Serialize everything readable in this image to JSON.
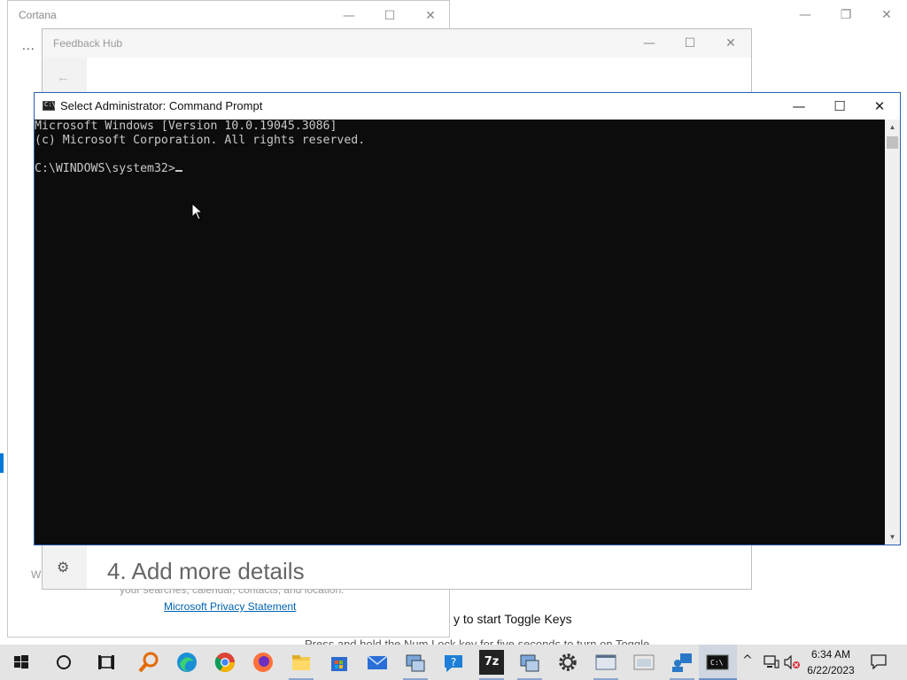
{
  "cortana": {
    "title": "Cortana",
    "dots": "...",
    "left_text": "Wi",
    "sub_text": "your searches, calendar, contacts, and location.",
    "privacy_link": "Microsoft Privacy Statement"
  },
  "background": {
    "toggle_keys_text": "y to start Toggle Keys",
    "numlock_text": "Press and hold the Num Lock key for five seconds to turn on Toggle"
  },
  "feedback_hub": {
    "title": "Feedback Hub",
    "back_glyph": "←",
    "settings_glyph": "⚙",
    "section_heading": "4. Add more details"
  },
  "cmd": {
    "title": "Select Administrator:  Command Prompt",
    "lines": [
      "Microsoft Windows [Version 10.0.19045.3086]",
      "(c) Microsoft Corporation. All rights reserved.",
      "",
      "C:\\WINDOWS\\system32>"
    ]
  },
  "window_controls": {
    "minimize": "—",
    "maximize": "☐",
    "close": "✕",
    "restore": "❐"
  },
  "taskbar": {
    "clock_time": "6:34 AM",
    "clock_date": "6/22/2023",
    "tray_chevron": "^",
    "apps": [
      {
        "name": "start-icon"
      },
      {
        "name": "cortana-search-icon"
      },
      {
        "name": "task-view-icon"
      },
      {
        "name": "search-magnifier-app-icon"
      },
      {
        "name": "edge-icon"
      },
      {
        "name": "chrome-icon"
      },
      {
        "name": "firefox-icon"
      },
      {
        "name": "file-explorer-icon"
      },
      {
        "name": "microsoft-store-icon"
      },
      {
        "name": "mail-icon"
      },
      {
        "name": "network-app-icon"
      },
      {
        "name": "help-icon"
      },
      {
        "name": "7zip-icon"
      },
      {
        "name": "network-app-2-icon"
      },
      {
        "name": "settings-icon"
      },
      {
        "name": "app-window-icon"
      },
      {
        "name": "app-window-2-icon"
      },
      {
        "name": "people-app-icon"
      },
      {
        "name": "command-prompt-icon"
      }
    ],
    "seven_zip_label": "7z"
  }
}
